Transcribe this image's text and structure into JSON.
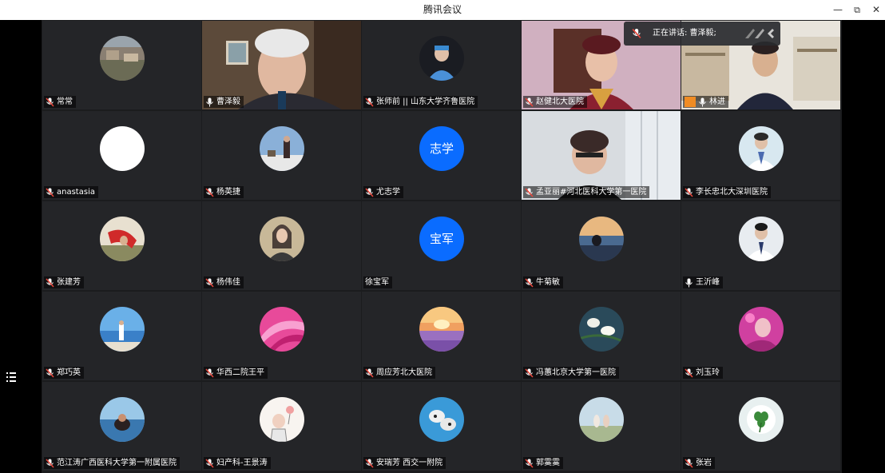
{
  "window": {
    "title": "腾讯会议",
    "minimize": "—",
    "restore": "⧉",
    "close": "✕"
  },
  "speaking_indicator": {
    "label": "正在讲话: 曹泽毅;"
  },
  "participants": [
    {
      "name": "常常"
    },
    {
      "name": "曹泽毅"
    },
    {
      "name": "张师前 || 山东大学齐鲁医院"
    },
    {
      "name": "赵健北大医院"
    },
    {
      "name": "林进"
    },
    {
      "name": "anastasia"
    },
    {
      "name": "杨英捷"
    },
    {
      "name": "尤志学",
      "avatar_text": "志学"
    },
    {
      "name": "孟亚丽#河北医科大学第一医院"
    },
    {
      "name": "李长忠北大深圳医院"
    },
    {
      "name": "张建芳"
    },
    {
      "name": "杨伟佳"
    },
    {
      "name": "徐宝军",
      "avatar_text": "宝军"
    },
    {
      "name": "牛菊敏"
    },
    {
      "name": "王沂峰"
    },
    {
      "name": "郑巧英"
    },
    {
      "name": "华西二院王平"
    },
    {
      "name": "周应芳北大医院"
    },
    {
      "name": "冯蕙北京大学第一医院"
    },
    {
      "name": "刘玉玲"
    },
    {
      "name": "范江涛广西医科大学第一附属医院"
    },
    {
      "name": "妇产科-王景涛"
    },
    {
      "name": "安瑞芳 西交一附院"
    },
    {
      "name": "郭霙霙"
    },
    {
      "name": "张岩"
    }
  ],
  "colors": {
    "tile_bg": "#242528",
    "accent_blue": "#0a6cff",
    "speaking_green": "#2ebd5f",
    "muted_red": "#e8463a",
    "share_orange": "#f08c24"
  }
}
